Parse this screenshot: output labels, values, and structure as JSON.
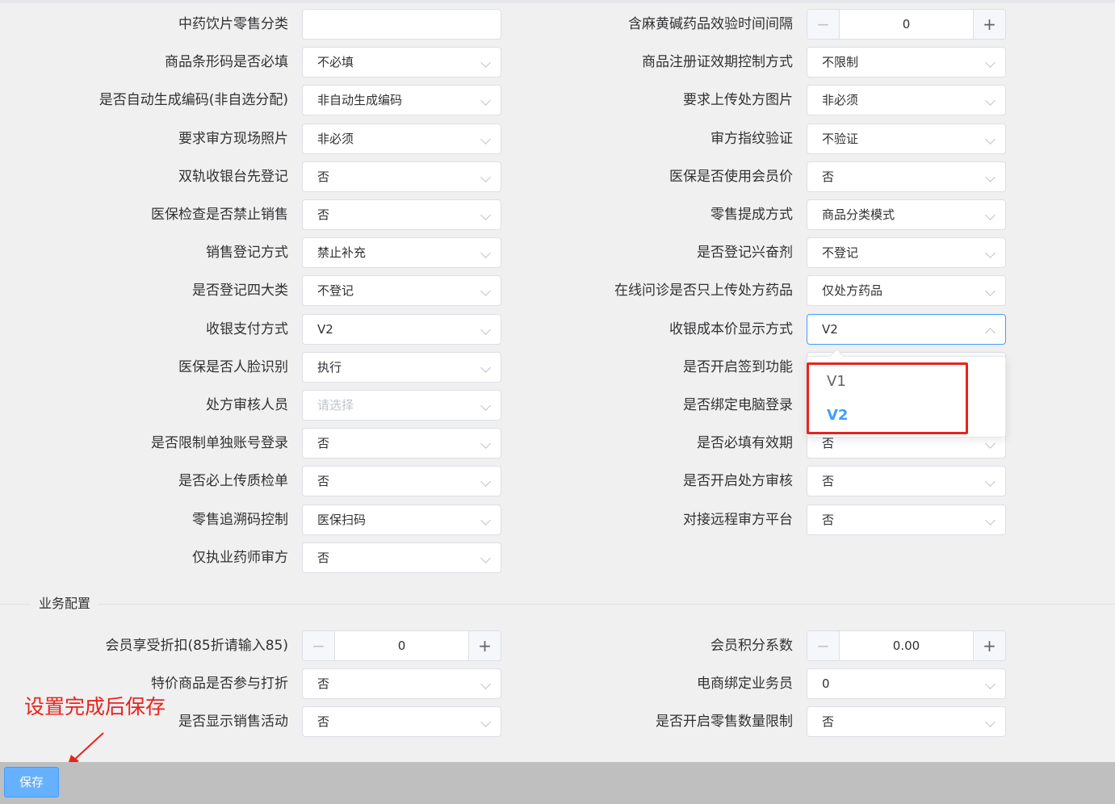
{
  "rows_left": [
    {
      "label": "中药饮片零售分类",
      "value": "",
      "type": "text"
    },
    {
      "label": "商品条形码是否必填",
      "value": "不必填",
      "type": "select"
    },
    {
      "label": "是否自动生成编码(非自选分配)",
      "value": "非自动生成编码",
      "type": "select"
    },
    {
      "label": "要求审方现场照片",
      "value": "非必须",
      "type": "select"
    },
    {
      "label": "双轨收银台先登记",
      "value": "否",
      "type": "select"
    },
    {
      "label": "医保检查是否禁止销售",
      "value": "否",
      "type": "select"
    },
    {
      "label": "销售登记方式",
      "value": "禁止补充",
      "type": "select"
    },
    {
      "label": "是否登记四大类",
      "value": "不登记",
      "type": "select"
    },
    {
      "label": "收银支付方式",
      "value": "V2",
      "type": "select"
    },
    {
      "label": "医保是否人脸识别",
      "value": "执行",
      "type": "select"
    },
    {
      "label": "处方审核人员",
      "value": "",
      "placeholder": "请选择",
      "type": "select"
    },
    {
      "label": "是否限制单独账号登录",
      "value": "否",
      "type": "select"
    },
    {
      "label": "是否必上传质检单",
      "value": "否",
      "type": "select"
    },
    {
      "label": "零售追溯码控制",
      "value": "医保扫码",
      "type": "select"
    },
    {
      "label": "仅执业药师审方",
      "value": "否",
      "type": "select"
    }
  ],
  "rows_right": [
    {
      "label": "含麻黄碱药品效验时间间隔",
      "value": "0",
      "type": "number",
      "minus": "−",
      "plus": "+"
    },
    {
      "label": "商品注册证效期控制方式",
      "value": "不限制",
      "type": "select"
    },
    {
      "label": "要求上传处方图片",
      "value": "非必须",
      "type": "select"
    },
    {
      "label": "审方指纹验证",
      "value": "不验证",
      "type": "select"
    },
    {
      "label": "医保是否使用会员价",
      "value": "否",
      "type": "select"
    },
    {
      "label": "零售提成方式",
      "value": "商品分类模式",
      "type": "select"
    },
    {
      "label": "是否登记兴奋剂",
      "value": "不登记",
      "type": "select"
    },
    {
      "label": "在线问诊是否只上传处方药品",
      "value": "仅处方药品",
      "type": "select"
    },
    {
      "label": "收银成本价显示方式",
      "value": "V2",
      "type": "select",
      "open": true
    },
    {
      "label": "是否开启签到功能",
      "value": "",
      "type": "select"
    },
    {
      "label": "是否绑定电脑登录",
      "value": "",
      "type": "select"
    },
    {
      "label": "是否必填有效期",
      "value": "否",
      "type": "select"
    },
    {
      "label": "是否开启处方审核",
      "value": "否",
      "type": "select"
    },
    {
      "label": "对接远程审方平台",
      "value": "否",
      "type": "select"
    }
  ],
  "dropdown": {
    "options": [
      "V1",
      "V2"
    ],
    "selected": "V2"
  },
  "section": {
    "title": "业务配置"
  },
  "biz_left": [
    {
      "label": "会员享受折扣(85折请输入85)",
      "value": "0",
      "type": "number",
      "minus": "−",
      "plus": "+"
    },
    {
      "label": "特价商品是否参与打折",
      "value": "否",
      "type": "select"
    },
    {
      "label": "是否显示销售活动",
      "value": "否",
      "type": "select"
    }
  ],
  "biz_right": [
    {
      "label": "会员积分系数",
      "value": "0.00",
      "type": "number",
      "minus": "−",
      "plus": "+"
    },
    {
      "label": "电商绑定业务员",
      "value": "0",
      "type": "select"
    },
    {
      "label": "是否开启零售数量限制",
      "value": "否",
      "type": "select"
    }
  ],
  "annotation": "设置完成后保存",
  "footer": {
    "save_label": "保存"
  },
  "colors": {
    "accent": "#409eff",
    "annotation": "#e8231e"
  }
}
